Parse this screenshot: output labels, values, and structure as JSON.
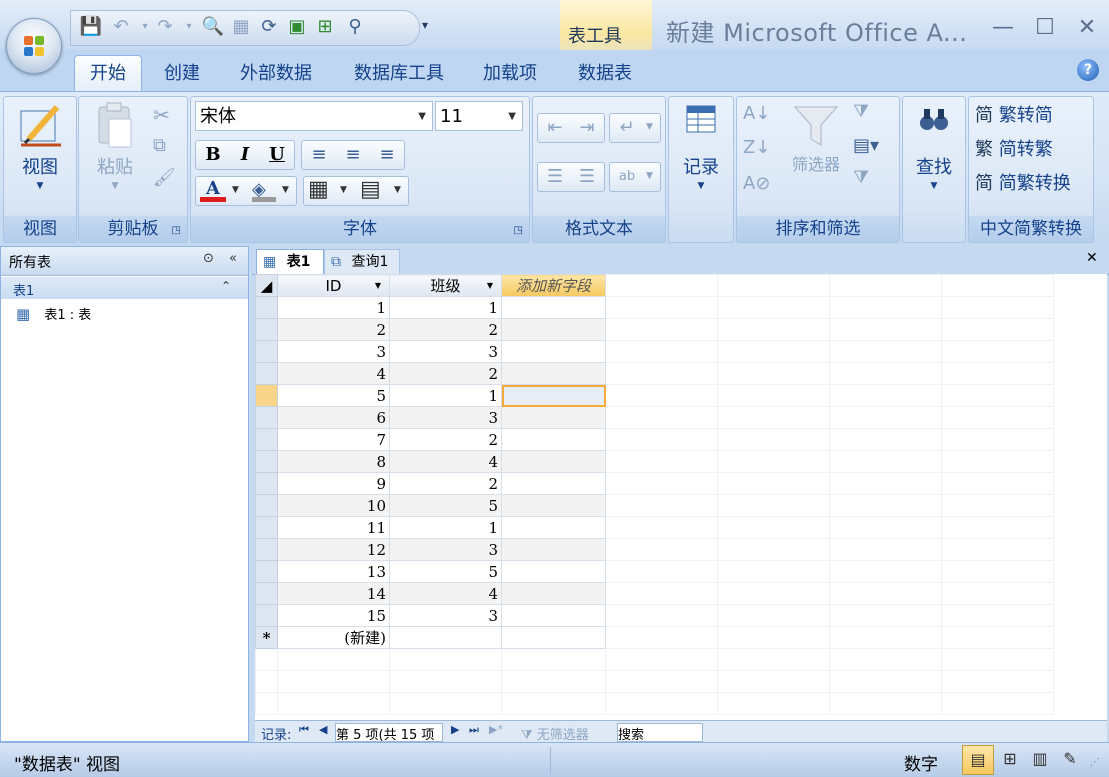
{
  "window": {
    "title": "新建 Microsoft Office A...",
    "context_tab_group": "表工具",
    "minimize": "—",
    "maximize": "☐",
    "close": "✕"
  },
  "ribbon_tabs": [
    "开始",
    "创建",
    "外部数据",
    "数据库工具",
    "加载项",
    "数据表"
  ],
  "ribbon": {
    "view": {
      "button": "视图",
      "group": "视图"
    },
    "clipboard": {
      "paste": "粘贴",
      "group": "剪贴板"
    },
    "font": {
      "name": "宋体",
      "size": "11",
      "bold": "B",
      "italic": "I",
      "underline": "U",
      "font_color": "A",
      "group": "字体"
    },
    "rich_text": {
      "group": "格式文本"
    },
    "records": {
      "button": "记录"
    },
    "sort_filter": {
      "filter": "筛选器",
      "group": "排序和筛选"
    },
    "find": {
      "button": "查找"
    },
    "chinese": {
      "to_simplified": "繁转简",
      "to_traditional": "简转繁",
      "convert": "简繁转换",
      "group": "中文简繁转换"
    }
  },
  "nav_pane": {
    "header": "所有表",
    "group": "表1",
    "item": "表1 : 表"
  },
  "doc_tabs": [
    "表1",
    "查询1"
  ],
  "sheet": {
    "columns": [
      "ID",
      "班级",
      "添加新字段"
    ],
    "rows": [
      {
        "id": "1",
        "class": "1"
      },
      {
        "id": "2",
        "class": "2"
      },
      {
        "id": "3",
        "class": "3"
      },
      {
        "id": "4",
        "class": "2"
      },
      {
        "id": "5",
        "class": "1"
      },
      {
        "id": "6",
        "class": "3"
      },
      {
        "id": "7",
        "class": "2"
      },
      {
        "id": "8",
        "class": "4"
      },
      {
        "id": "9",
        "class": "2"
      },
      {
        "id": "10",
        "class": "5"
      },
      {
        "id": "11",
        "class": "1"
      },
      {
        "id": "12",
        "class": "3"
      },
      {
        "id": "13",
        "class": "5"
      },
      {
        "id": "14",
        "class": "4"
      },
      {
        "id": "15",
        "class": "3"
      }
    ],
    "new_row_marker": "*",
    "new_row_label": "(新建)"
  },
  "record_nav": {
    "label": "记录:",
    "position": "第 5 项(共 15 项",
    "no_filter": "无筛选器",
    "search_placeholder": "搜索"
  },
  "status": {
    "left": "\"数据表\" 视图",
    "right": "数字"
  }
}
